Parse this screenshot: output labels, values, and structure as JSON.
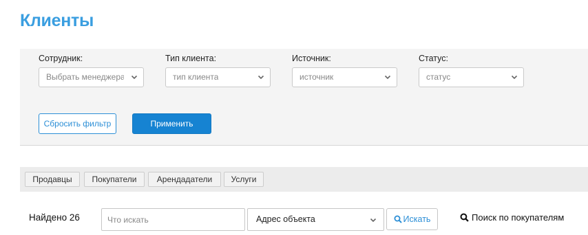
{
  "page": {
    "title": "Клиенты"
  },
  "filters": {
    "employee": {
      "label": "Сотрудник:",
      "value": "Выбрать менеджера"
    },
    "client_type": {
      "label": "Тип клиента:",
      "value": "тип клиента"
    },
    "source": {
      "label": "Источник:",
      "value": "источник"
    },
    "status": {
      "label": "Статус:",
      "value": "статус"
    },
    "reset_label": "Сбросить фильтр",
    "apply_label": "Применить"
  },
  "tabs": [
    {
      "label": "Продавцы"
    },
    {
      "label": "Покупатели"
    },
    {
      "label": "Арендадатели"
    },
    {
      "label": "Услуги"
    }
  ],
  "search": {
    "found_text": "Найдено 26",
    "query_placeholder": "Что искать",
    "query_value": "",
    "field_selected": "Адрес объекта",
    "submit_label": "Искать",
    "buyer_search_label": "Поиск по покупателям"
  },
  "icons": {
    "search": "search-icon",
    "chevron": "chevron-down-icon"
  },
  "colors": {
    "accent": "#3a9ee0",
    "primary_button": "#1683d2",
    "link": "#2b8ed6"
  }
}
